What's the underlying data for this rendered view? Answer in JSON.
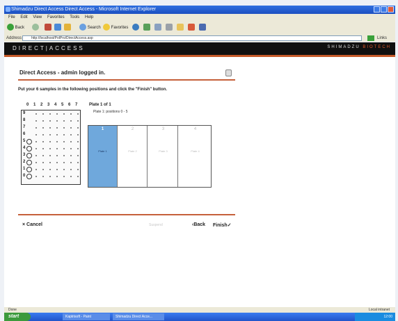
{
  "window": {
    "title": "Shimadzu Direct Access Direct Access - Microsoft Internet Explorer"
  },
  "menu": [
    "File",
    "Edit",
    "View",
    "Favorites",
    "Tools",
    "Help"
  ],
  "toolbar": {
    "back": "Back",
    "search": "Search",
    "favorites": "Favorites"
  },
  "address": {
    "label": "Address",
    "url": "http://localhost/PolPro/DirectAccess.asp",
    "links": "Links"
  },
  "brand": {
    "left": "DIRECT|ACCESS",
    "right_prefix": "SHIMADZU",
    "right_suffix": "BIOTECH"
  },
  "page": {
    "headline": "Direct Access - admin logged in.",
    "instruction": "Put your 6 samples in the following positions and click the \"Finish\" button."
  },
  "grid": {
    "columns": [
      "0",
      "1",
      "2",
      "3",
      "4",
      "5",
      "6",
      "7"
    ],
    "rows": [
      "9",
      "8",
      "7",
      "6",
      "5",
      "4",
      "3",
      "2",
      "1",
      "0"
    ]
  },
  "plate": {
    "title": "Plate 1 of 1",
    "subtitle": "Plate 1: positions 0 - 5",
    "trays": [
      {
        "num": "1",
        "label": "Plate 1",
        "active": true
      },
      {
        "num": "2",
        "label": "Plate 2",
        "active": false
      },
      {
        "num": "3",
        "label": "Plate 3",
        "active": false
      },
      {
        "num": "4",
        "label": "Plate 4",
        "active": false
      }
    ]
  },
  "actions": {
    "cancel": "Cancel",
    "suspend": "Suspend",
    "back": "Back",
    "finish": "Finish"
  },
  "status": {
    "left": "Done",
    "right": "Local intranet"
  },
  "taskbar": {
    "start": "start",
    "tasks": [
      "Kaptrisoft - Paint",
      "Shimadzu Direct Acce..."
    ],
    "clock": "12:00"
  }
}
